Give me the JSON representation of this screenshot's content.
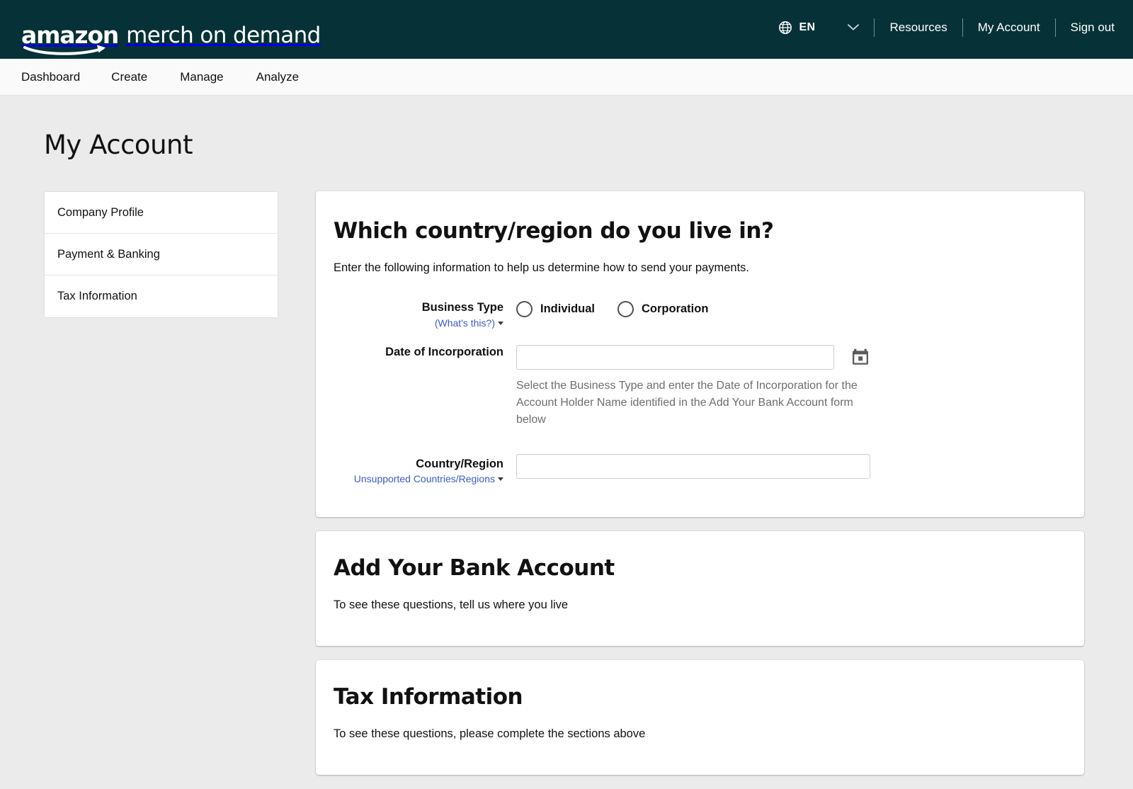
{
  "header": {
    "brand_amazon": "amazon",
    "brand_rest": "merch on demand",
    "language_code": "EN",
    "links": [
      {
        "label": "Resources"
      },
      {
        "label": "My Account"
      },
      {
        "label": "Sign out"
      }
    ]
  },
  "subnav": {
    "items": [
      {
        "label": "Dashboard"
      },
      {
        "label": "Create"
      },
      {
        "label": "Manage"
      },
      {
        "label": "Analyze"
      }
    ]
  },
  "page": {
    "title": "My Account"
  },
  "sidebar": {
    "items": [
      {
        "label": "Company Profile"
      },
      {
        "label": "Payment & Banking"
      },
      {
        "label": "Tax Information"
      }
    ]
  },
  "cards": {
    "country": {
      "title": "Which country/region do you live in?",
      "subtitle": "Enter the following information to help us determine how to send your payments.",
      "business_type": {
        "label": "Business Type",
        "help_link": "(What's this?)",
        "options": [
          {
            "label": "Individual",
            "selected": false
          },
          {
            "label": "Corporation",
            "selected": false
          }
        ]
      },
      "date_of_incorporation": {
        "label": "Date of Incorporation",
        "value": "",
        "placeholder": "",
        "help_text": "Select the Business Type and enter the Date of Incorporation for the Account Holder Name identified in the Add Your Bank Account form below"
      },
      "country_region": {
        "label": "Country/Region",
        "help_link": "Unsupported Countries/Regions",
        "value": "",
        "placeholder": ""
      }
    },
    "bank": {
      "title": "Add Your Bank Account",
      "subtitle": "To see these questions, tell us where you live"
    },
    "tax": {
      "title": "Tax Information",
      "subtitle": "To see these questions, please complete the sections above"
    }
  },
  "colors": {
    "header_bg": "#063237",
    "page_bg": "#ebebeb",
    "link_blue": "#3b5bc4",
    "help_gray": "#6d6d6d"
  }
}
